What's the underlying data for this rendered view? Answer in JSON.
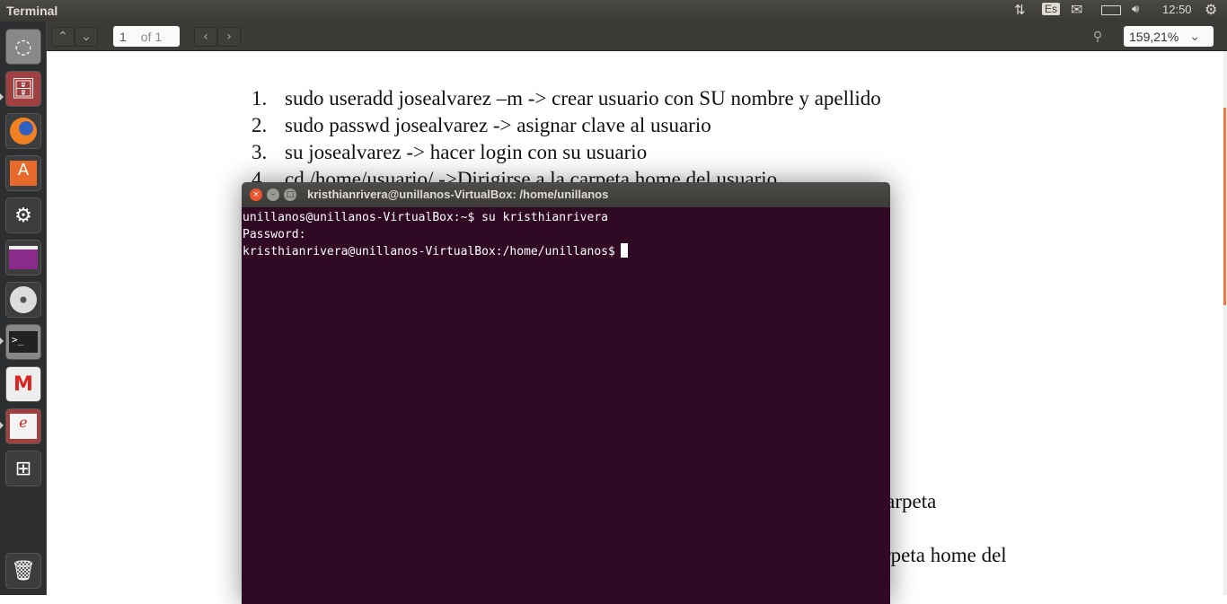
{
  "top_panel": {
    "app_title": "Terminal",
    "keyboard_layout": "Es",
    "clock": "12:50"
  },
  "launcher": {
    "items": [
      "ubuntu-dash",
      "files",
      "firefox",
      "software-center",
      "system-settings",
      "app-window",
      "dvd",
      "terminal",
      "gmail",
      "document-viewer",
      "workspace-switcher",
      "trash"
    ]
  },
  "toolbar": {
    "page_number": "1",
    "page_total": "of 1",
    "zoom_level": "159,21%"
  },
  "document": {
    "list": [
      {
        "num": "1.",
        "text": "sudo  useradd josealvarez –m -> crear usuario con SU nombre y apellido"
      },
      {
        "num": "2.",
        "text": "sudo passwd josealvarez -> asignar clave al usuario"
      },
      {
        "num": "3.",
        "text": "su josealvarez -> hacer login con su usuario"
      },
      {
        "num": "4.",
        "text": "cd /home/usuario/ ->Dirigirse a la carpeta home del usuario"
      }
    ],
    "fragment_1": "a carpeta",
    "fragment_2": "rpeta home del"
  },
  "terminal": {
    "title": "kristhianrivera@unillanos-VirtualBox: /home/unillanos",
    "lines": [
      "unillanos@unillanos-VirtualBox:~$ su kristhianrivera",
      "Password:",
      "kristhianrivera@unillanos-VirtualBox:/home/unillanos$"
    ]
  },
  "colors": {
    "terminal_bg": "#300a24",
    "accent": "#f07746",
    "panel": "#3c3b37"
  }
}
